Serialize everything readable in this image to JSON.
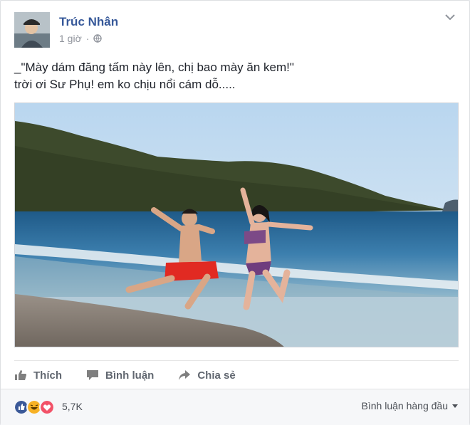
{
  "post": {
    "author": "Trúc Nhân",
    "time": "1 giờ",
    "text_line1": "_\"Mày dám đăng tấm này lên, chị bao mày ăn kem!\"",
    "text_line2": "trời ơi Sư Phụ! em ko chịu nổi cám dỗ....."
  },
  "actions": {
    "like": "Thích",
    "comment": "Bình luận",
    "share": "Chia sẻ"
  },
  "footer": {
    "reaction_count": "5,7K",
    "sort_label": "Bình luận hàng đầu"
  },
  "icons": {
    "privacy": "globe-icon",
    "menu": "chevron-down-icon",
    "like": "thumbs-up-icon",
    "comment": "comment-icon",
    "share": "share-arrow-icon"
  },
  "colors": {
    "link": "#365899",
    "action_text": "#616770",
    "like_reaction": "#3b5998",
    "haha_reaction": "#f7b125",
    "love_reaction": "#f25268"
  }
}
